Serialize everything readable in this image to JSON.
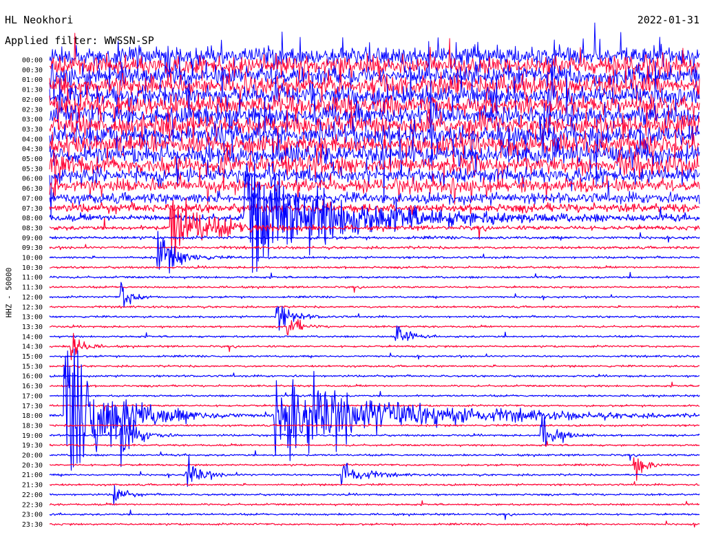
{
  "header": {
    "station": "HL Neokhori",
    "filter": "Applied filter: WWSSN-SP",
    "date": "2022-01-31"
  },
  "chart_data": {
    "type": "line",
    "title": "HL Neokhori",
    "subtitle": "Applied filter: WWSSN-SP",
    "date": "2022-01-31",
    "ylabel": "HHZ - 50000",
    "row_labels": [
      "00:00",
      "00:30",
      "01:00",
      "01:30",
      "02:00",
      "02:30",
      "03:00",
      "03:30",
      "04:00",
      "04:30",
      "05:00",
      "05:30",
      "06:00",
      "06:30",
      "07:00",
      "07:30",
      "08:00",
      "08:30",
      "09:00",
      "09:30",
      "10:00",
      "10:30",
      "11:00",
      "11:30",
      "12:00",
      "12:30",
      "13:00",
      "13:30",
      "14:00",
      "14:30",
      "15:00",
      "15:30",
      "16:00",
      "16:30",
      "17:00",
      "17:30",
      "18:00",
      "18:30",
      "19:00",
      "19:30",
      "20:00",
      "20:30",
      "21:00",
      "21:30",
      "22:00",
      "22:30",
      "23:00",
      "23:30"
    ],
    "trace_colors": [
      "#0000ff",
      "#ff0033"
    ],
    "noise_level_by_row": [
      9,
      9,
      9,
      9,
      9,
      9,
      9,
      9,
      9,
      9,
      9,
      8,
      7,
      6,
      5,
      4,
      3,
      2,
      1.4,
      1.2,
      1,
      1,
      1,
      0.9,
      0.9,
      0.9,
      0.9,
      0.9,
      0.9,
      0.9,
      0.9,
      0.9,
      0.9,
      0.9,
      0.9,
      0.9,
      0.9,
      0.9,
      0.9,
      0.9,
      0.9,
      0.9,
      0.9,
      0.9,
      0.9,
      0.9,
      0.9,
      0.9
    ],
    "events": [
      {
        "row": 16,
        "minute": 9.0,
        "strength": 10,
        "span": 40
      },
      {
        "row": 17,
        "minute": 5.6,
        "strength": 6,
        "span": 16
      },
      {
        "row": 20,
        "minute": 5.0,
        "strength": 4,
        "span": 8
      },
      {
        "row": 24,
        "minute": 3.3,
        "strength": 3,
        "span": 4
      },
      {
        "row": 26,
        "minute": 10.5,
        "strength": 3,
        "span": 6
      },
      {
        "row": 27,
        "minute": 11.0,
        "strength": 3,
        "span": 4
      },
      {
        "row": 28,
        "minute": 16.0,
        "strength": 3,
        "span": 4
      },
      {
        "row": 29,
        "minute": 1.0,
        "strength": 4,
        "span": 4
      },
      {
        "row": 36,
        "minute": 10.4,
        "strength": 8,
        "span": 50
      },
      {
        "row": 36,
        "minute": 0.7,
        "strength": 14,
        "span": 20
      },
      {
        "row": 38,
        "minute": 3.3,
        "strength": 5,
        "span": 6
      },
      {
        "row": 38,
        "minute": 22.7,
        "strength": 4,
        "span": 6
      },
      {
        "row": 41,
        "minute": 27.0,
        "strength": 3,
        "span": 4
      },
      {
        "row": 42,
        "minute": 6.3,
        "strength": 3,
        "span": 6
      },
      {
        "row": 42,
        "minute": 13.5,
        "strength": 3,
        "span": 8
      },
      {
        "row": 44,
        "minute": 3.0,
        "strength": 2,
        "span": 4
      }
    ]
  }
}
